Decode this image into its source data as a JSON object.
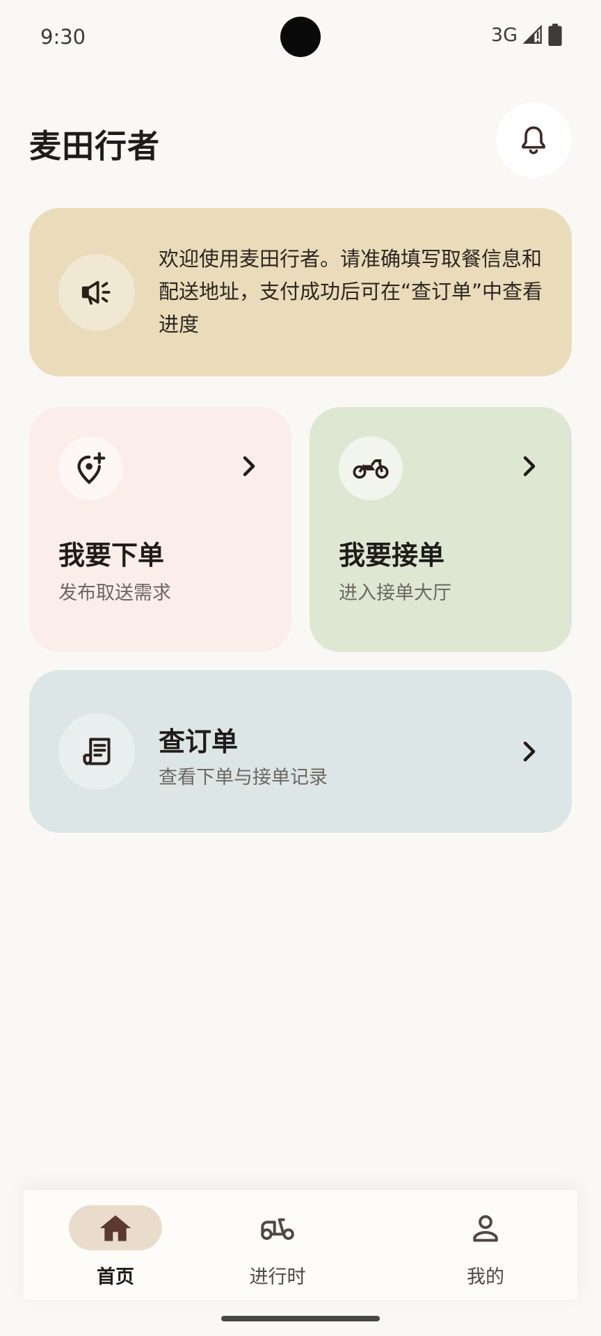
{
  "status_bar": {
    "time": "9:30",
    "network": "3G"
  },
  "header": {
    "title": "麦田行者"
  },
  "notice": {
    "text": "欢迎使用麦田行者。请准确填写取餐信息和配送地址，支付成功后可在“查订单”中查看进度"
  },
  "tiles": [
    {
      "title": "我要下单",
      "subtitle": "发布取送需求",
      "icon": "add-location-icon"
    },
    {
      "title": "我要接单",
      "subtitle": "进入接单大厅",
      "icon": "motorcycle-icon"
    }
  ],
  "orders_card": {
    "title": "查订单",
    "subtitle": "查看下单与接单记录",
    "icon": "receipt-icon"
  },
  "bottom_nav": {
    "items": [
      {
        "label": "首页",
        "icon": "home-icon",
        "selected": true
      },
      {
        "label": "进行时",
        "icon": "scooter-icon",
        "selected": false
      },
      {
        "label": "我的",
        "icon": "person-icon",
        "selected": false
      }
    ]
  },
  "colors": {
    "background": "#F9F8F4",
    "notice": "#EADCBA",
    "order_tile": "#FBEDE9",
    "accept_tile": "#DDE7D2",
    "orders_card": "#DCE6E7",
    "nav_selected": "#EADCCB"
  }
}
